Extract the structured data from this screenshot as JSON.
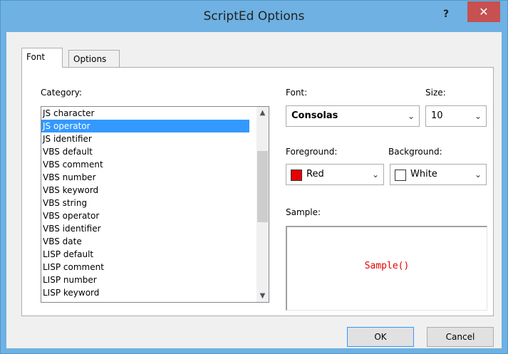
{
  "window": {
    "title": "ScriptEd Options",
    "help_label": "?",
    "close_label": "✕"
  },
  "tabs": [
    {
      "label": "Font"
    },
    {
      "label": "Options"
    }
  ],
  "category": {
    "label": "Category:",
    "items": [
      "JS character",
      "JS operator",
      "JS identifier",
      "VBS default",
      "VBS comment",
      "VBS number",
      "VBS keyword",
      "VBS string",
      "VBS operator",
      "VBS identifier",
      "VBS date",
      "LISP default",
      "LISP comment",
      "LISP number",
      "LISP keyword"
    ],
    "selected": "JS operator"
  },
  "font": {
    "label": "Font:",
    "value": "Consolas"
  },
  "size": {
    "label": "Size:",
    "value": "10"
  },
  "foreground": {
    "label": "Foreground:",
    "value": "Red",
    "color": "#e60000"
  },
  "background": {
    "label": "Background:",
    "value": "White",
    "color": "#ffffff"
  },
  "sample": {
    "label": "Sample:",
    "text": "Sample()"
  },
  "buttons": {
    "ok": "OK",
    "cancel": "Cancel"
  },
  "icons": {
    "up": "▲",
    "down": "▼",
    "dropdown": "⌄"
  }
}
